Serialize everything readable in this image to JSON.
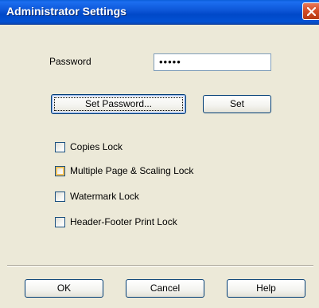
{
  "window": {
    "title": "Administrator Settings"
  },
  "password": {
    "label": "Password",
    "value": "•••••"
  },
  "buttons": {
    "set_password": "Set Password...",
    "set": "Set",
    "ok": "OK",
    "cancel": "Cancel",
    "help": "Help"
  },
  "locks": [
    {
      "label": "Copies Lock",
      "checked": false
    },
    {
      "label": "Multiple Page & Scaling Lock",
      "checked": false
    },
    {
      "label": "Watermark Lock",
      "checked": false
    },
    {
      "label": "Header-Footer Print Lock",
      "checked": false
    }
  ],
  "colors": {
    "titlebar": "#0048c8",
    "dialog_bg": "#ece9d8",
    "close_button": "#d24a24",
    "hover_accent": "#f6c25a"
  }
}
